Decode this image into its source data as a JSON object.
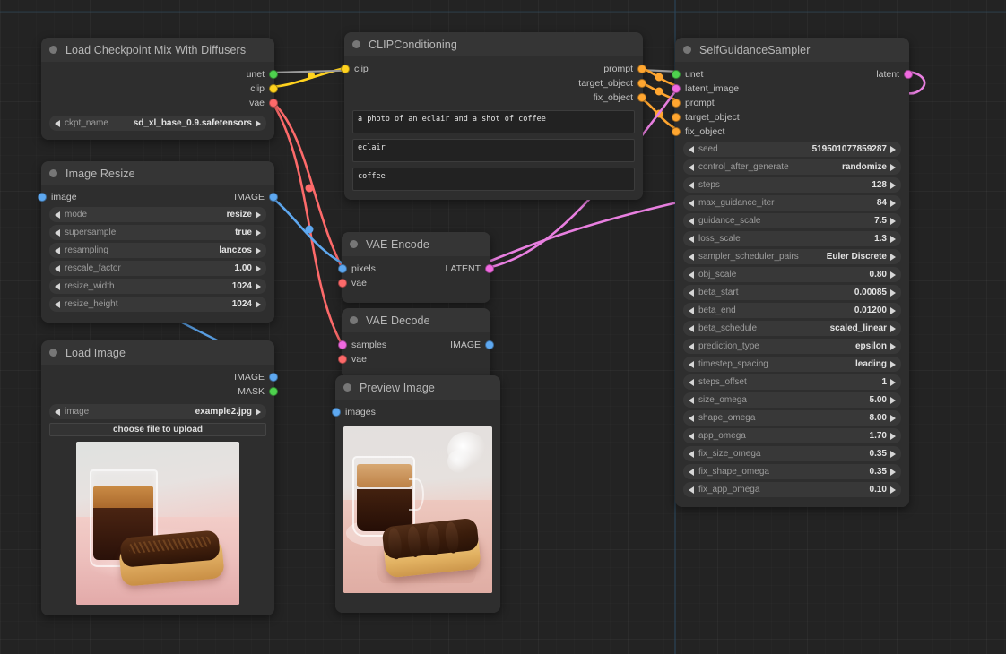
{
  "canvas": {
    "background": "#232323",
    "grid": true,
    "axis_color": "#2b4159"
  },
  "nodes": [
    {
      "id": "load_checkpoint",
      "title": "Load Checkpoint Mix With Diffusers",
      "inputs": [],
      "outputs": [
        {
          "label": "unet",
          "color": "#4ed14e"
        },
        {
          "label": "clip",
          "color": "#ffd21e"
        },
        {
          "label": "vae",
          "color": "#fd6a6a"
        }
      ],
      "widgets": [
        {
          "name": "ckpt_name",
          "value": "sd_xl_base_0.9.safetensors"
        }
      ]
    },
    {
      "id": "image_resize",
      "title": "Image Resize",
      "inputs": [
        {
          "label": "image",
          "color": "#5ea8f0"
        }
      ],
      "outputs": [
        {
          "label": "IMAGE",
          "color": "#5ea8f0"
        }
      ],
      "widgets": [
        {
          "name": "mode",
          "value": "resize"
        },
        {
          "name": "supersample",
          "value": "true"
        },
        {
          "name": "resampling",
          "value": "lanczos"
        },
        {
          "name": "rescale_factor",
          "value": "1.00"
        },
        {
          "name": "resize_width",
          "value": "1024"
        },
        {
          "name": "resize_height",
          "value": "1024"
        }
      ]
    },
    {
      "id": "load_image",
      "title": "Load Image",
      "inputs": [],
      "outputs": [
        {
          "label": "IMAGE",
          "color": "#5ea8f0"
        },
        {
          "label": "MASK",
          "color": "#4ed14e"
        }
      ],
      "widgets": [
        {
          "name": "image",
          "value": "example2.jpg"
        }
      ],
      "button": "choose file to upload",
      "thumbnail": "espresso-glass-and-chocolate-eclair"
    },
    {
      "id": "clip_conditioning",
      "title": "CLIPConditioning",
      "inputs": [
        {
          "label": "clip",
          "color": "#ffd21e"
        }
      ],
      "outputs": [
        {
          "label": "prompt",
          "color": "#ffa630"
        },
        {
          "label": "target_object",
          "color": "#ffa630"
        },
        {
          "label": "fix_object",
          "color": "#ffa630"
        }
      ],
      "texts": [
        "a photo of an eclair and a shot of coffee",
        "eclair",
        "coffee"
      ]
    },
    {
      "id": "vae_encode",
      "title": "VAE Encode",
      "inputs": [
        {
          "label": "pixels",
          "color": "#5ea8f0"
        },
        {
          "label": "vae",
          "color": "#fd6a6a"
        }
      ],
      "outputs": [
        {
          "label": "LATENT",
          "color": "#f06ae0"
        }
      ]
    },
    {
      "id": "vae_decode",
      "title": "VAE Decode",
      "inputs": [
        {
          "label": "samples",
          "color": "#f06ae0"
        },
        {
          "label": "vae",
          "color": "#fd6a6a"
        }
      ],
      "outputs": [
        {
          "label": "IMAGE",
          "color": "#5ea8f0"
        }
      ]
    },
    {
      "id": "preview_image",
      "title": "Preview Image",
      "inputs": [
        {
          "label": "images",
          "color": "#5ea8f0"
        }
      ],
      "outputs": [],
      "thumbnail": "coffee-cup-and-chocolate-eclair"
    },
    {
      "id": "self_guidance_sampler",
      "title": "SelfGuidanceSampler",
      "inputs": [
        {
          "label": "unet",
          "color": "#4ed14e"
        },
        {
          "label": "latent_image",
          "color": "#f06ae0"
        },
        {
          "label": "prompt",
          "color": "#ffa630"
        },
        {
          "label": "target_object",
          "color": "#ffa630"
        },
        {
          "label": "fix_object",
          "color": "#ffa630"
        }
      ],
      "outputs": [
        {
          "label": "latent",
          "color": "#f06ae0"
        }
      ],
      "widgets": [
        {
          "name": "seed",
          "value": "519501077859287"
        },
        {
          "name": "control_after_generate",
          "value": "randomize"
        },
        {
          "name": "steps",
          "value": "128"
        },
        {
          "name": "max_guidance_iter",
          "value": "84"
        },
        {
          "name": "guidance_scale",
          "value": "7.5"
        },
        {
          "name": "loss_scale",
          "value": "1.3"
        },
        {
          "name": "sampler_scheduler_pairs",
          "value": "Euler Discrete"
        },
        {
          "name": "obj_scale",
          "value": "0.80"
        },
        {
          "name": "beta_start",
          "value": "0.00085"
        },
        {
          "name": "beta_end",
          "value": "0.01200"
        },
        {
          "name": "beta_schedule",
          "value": "scaled_linear"
        },
        {
          "name": "prediction_type",
          "value": "epsilon"
        },
        {
          "name": "timestep_spacing",
          "value": "leading"
        },
        {
          "name": "steps_offset",
          "value": "1"
        },
        {
          "name": "size_omega",
          "value": "5.00"
        },
        {
          "name": "shape_omega",
          "value": "8.00"
        },
        {
          "name": "app_omega",
          "value": "1.70"
        },
        {
          "name": "fix_size_omega",
          "value": "0.35"
        },
        {
          "name": "fix_shape_omega",
          "value": "0.35"
        },
        {
          "name": "fix_app_omega",
          "value": "0.10"
        }
      ]
    }
  ],
  "link_colors": {
    "model": "#4ed14e",
    "clip": "#ffd21e",
    "vae": "#fd6a6a",
    "image": "#5ea8f0",
    "latent": "#f06ae0",
    "cond": "#ffa630"
  }
}
